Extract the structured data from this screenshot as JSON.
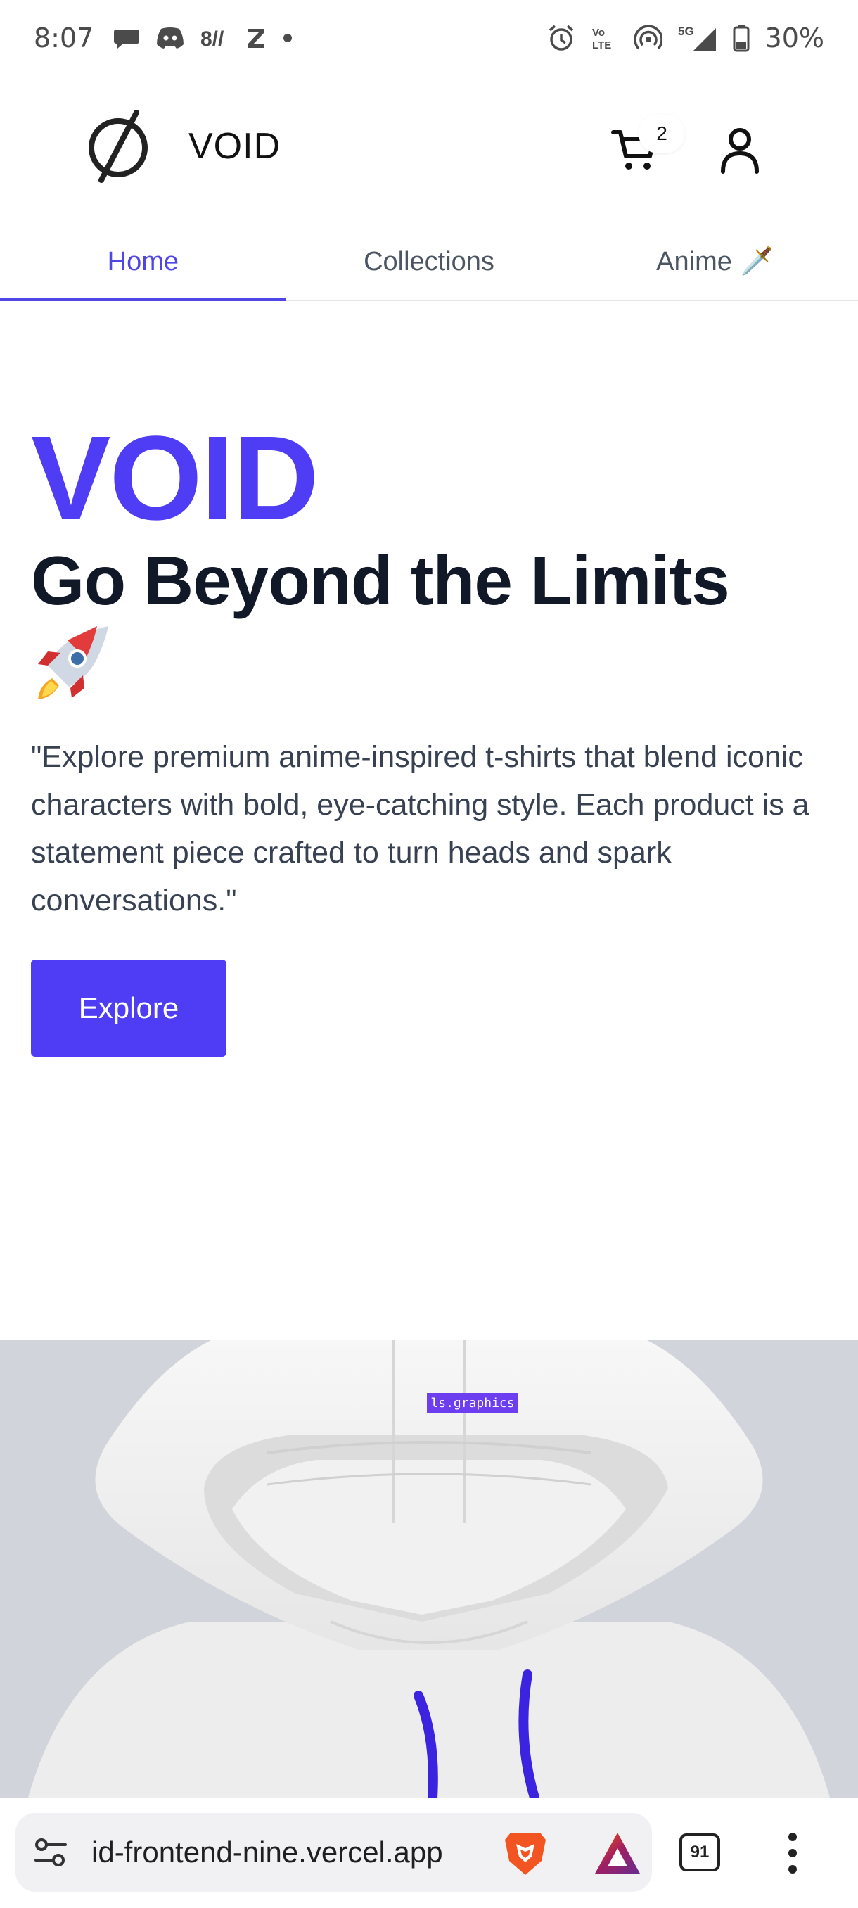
{
  "status_bar": {
    "time": "8:07",
    "network": "5G",
    "battery": "30%"
  },
  "header": {
    "brand": "VOID",
    "cart_count": "2"
  },
  "tabs": [
    {
      "label": "Home",
      "active": true
    },
    {
      "label": "Collections",
      "active": false
    },
    {
      "label": "Anime",
      "emoji": "🗡️",
      "active": false
    }
  ],
  "hero": {
    "brand": "VOID",
    "title": "Go Beyond the Limits",
    "description": "\"Explore premium anime-inspired t-shirts that blend iconic characters with bold, eye-catching style. Each product is a statement piece crafted to turn heads and spark conversations.\"",
    "button_label": "Explore"
  },
  "image": {
    "label_text": "ls.graphics"
  },
  "browser": {
    "url": "id-frontend-nine.vercel.app",
    "tab_count": "91"
  },
  "colors": {
    "accent": "#4f3cf5",
    "tab_active": "#4f46e5",
    "text_dark": "#111827"
  }
}
